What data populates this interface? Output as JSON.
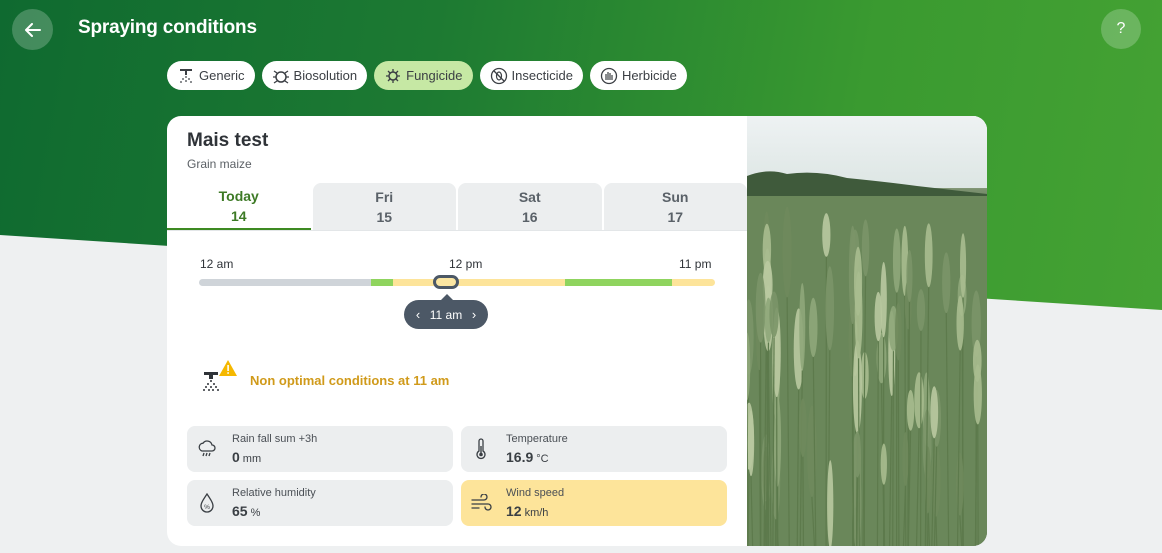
{
  "header": {
    "title": "Spraying conditions",
    "help_label": "?"
  },
  "chips": [
    {
      "label": "Generic",
      "icon": "sprayer-icon",
      "active": false
    },
    {
      "label": "Biosolution",
      "icon": "bug-icon",
      "active": false
    },
    {
      "label": "Fungicide",
      "icon": "virus-icon",
      "active": true
    },
    {
      "label": "Insecticide",
      "icon": "insect-crossed-icon",
      "active": false
    },
    {
      "label": "Herbicide",
      "icon": "grass-icon",
      "active": false
    }
  ],
  "field": {
    "name": "Mais test",
    "crop": "Grain maize"
  },
  "tabs": [
    {
      "day": "Today",
      "date": "14",
      "active": true
    },
    {
      "day": "Fri",
      "date": "15",
      "active": false
    },
    {
      "day": "Sat",
      "date": "16",
      "active": false
    },
    {
      "day": "Sun",
      "date": "17",
      "active": false
    }
  ],
  "timeline": {
    "label_start": "12 am",
    "label_mid": "12 pm",
    "label_end": "11 pm",
    "selected_time": "11 am",
    "selected_hour": 11,
    "segments": [
      {
        "hours": 8,
        "status": "past",
        "color": "#cfd4d9"
      },
      {
        "hours": 1,
        "status": "optimal",
        "color": "#8fd45e"
      },
      {
        "hours": 8,
        "status": "non-optimal",
        "color": "#fde49a"
      },
      {
        "hours": 5,
        "status": "optimal",
        "color": "#8fd45e"
      },
      {
        "hours": 2,
        "status": "non-optimal",
        "color": "#fde49a"
      }
    ]
  },
  "status": {
    "text": "Non optimal conditions at 11 am",
    "color": "#d09a1a"
  },
  "metrics": {
    "rain": {
      "label": "Rain fall sum +3h",
      "value": "0",
      "unit": "mm"
    },
    "temperature": {
      "label": "Temperature",
      "value": "16.9",
      "unit": "°C"
    },
    "humidity": {
      "label": "Relative humidity",
      "value": "65",
      "unit": "%"
    },
    "wind": {
      "label": "Wind speed",
      "value": "12",
      "unit": "km/h"
    }
  },
  "colors": {
    "brand_green": "#1d7a32",
    "active_chip": "#c6e8a4",
    "warning": "#fde49a"
  }
}
